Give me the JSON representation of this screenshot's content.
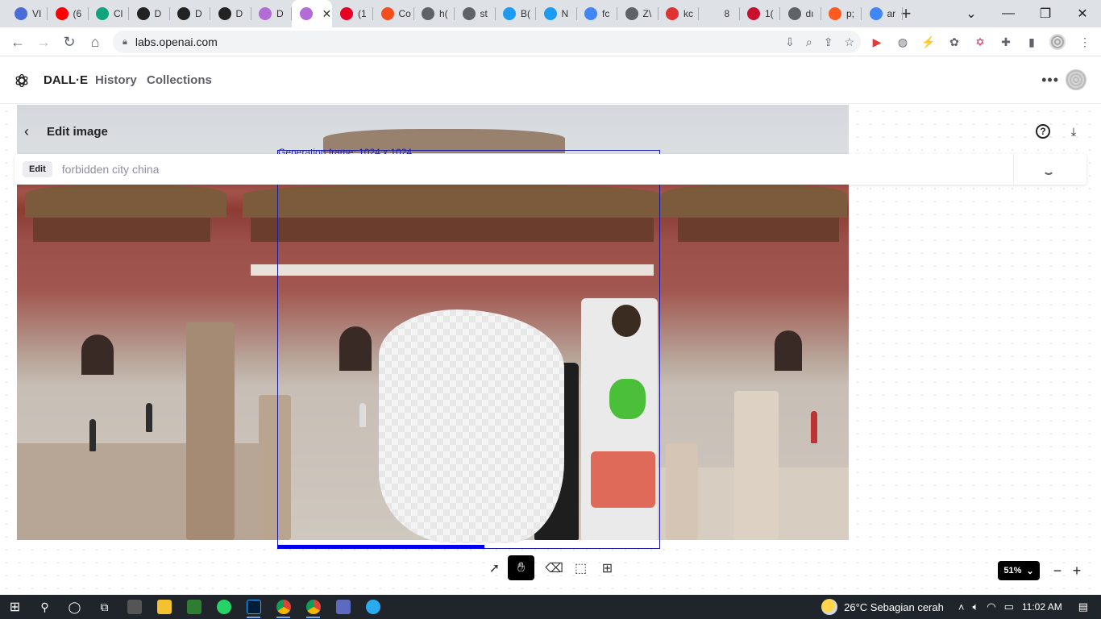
{
  "browser": {
    "tabs": [
      {
        "label": "VI",
        "favicon": "gear-icon",
        "color": "#4a6cd8"
      },
      {
        "label": "(6",
        "favicon": "youtube-icon",
        "color": "#ff0000"
      },
      {
        "label": "Cl",
        "favicon": "openai-icon",
        "color": "#10a37f"
      },
      {
        "label": "D",
        "favicon": "openai-icon",
        "color": "#222222"
      },
      {
        "label": "D",
        "favicon": "openai-icon",
        "color": "#222222"
      },
      {
        "label": "D",
        "favicon": "openai-icon",
        "color": "#222222"
      },
      {
        "label": "D",
        "favicon": "dalle-icon",
        "color": "#b36bd6"
      },
      {
        "label": "",
        "favicon": "dalle-icon",
        "color": "#b36bd6",
        "active": true
      },
      {
        "label": "(1",
        "favicon": "pinterest-icon",
        "color": "#e60023"
      },
      {
        "label": "Co",
        "favicon": "figma-icon",
        "color": "#f24e1e"
      },
      {
        "label": "h(",
        "favicon": "globe-icon",
        "color": "#5f6368"
      },
      {
        "label": "st",
        "favicon": "globe-icon",
        "color": "#5f6368"
      },
      {
        "label": "B(",
        "favicon": "twitter-icon",
        "color": "#1d9bf0"
      },
      {
        "label": "N",
        "favicon": "twitter-icon",
        "color": "#1d9bf0"
      },
      {
        "label": "fc",
        "favicon": "google-icon",
        "color": "#4285f4"
      },
      {
        "label": "Z\\",
        "favicon": "globe-icon",
        "color": "#5f6368"
      },
      {
        "label": "kc",
        "favicon": "dash-icon",
        "color": "#d33"
      },
      {
        "label": "8",
        "favicon": "blank-icon",
        "color": "#dee1e6"
      },
      {
        "label": "1(",
        "favicon": "pin-icon",
        "color": "#c8102e"
      },
      {
        "label": "dı",
        "favicon": "globe-icon",
        "color": "#5f6368"
      },
      {
        "label": "p;",
        "favicon": "fire-icon",
        "color": "#ff5a1f"
      },
      {
        "label": "ar",
        "favicon": "google-icon",
        "color": "#4285f4"
      }
    ],
    "url": "labs.openai.com"
  },
  "app": {
    "brand": "DALL·E",
    "nav": [
      "History",
      "Collections"
    ]
  },
  "editor": {
    "title": "Edit image",
    "mode_chip": "Edit",
    "prompt": "forbidden city china",
    "frame_label": "Generation frame: 1024 x 1024",
    "progress": 0.54,
    "zoom": "51%"
  },
  "taskbar": {
    "weather": "26°C  Sebagian cerah",
    "time": "11:02 AM"
  }
}
